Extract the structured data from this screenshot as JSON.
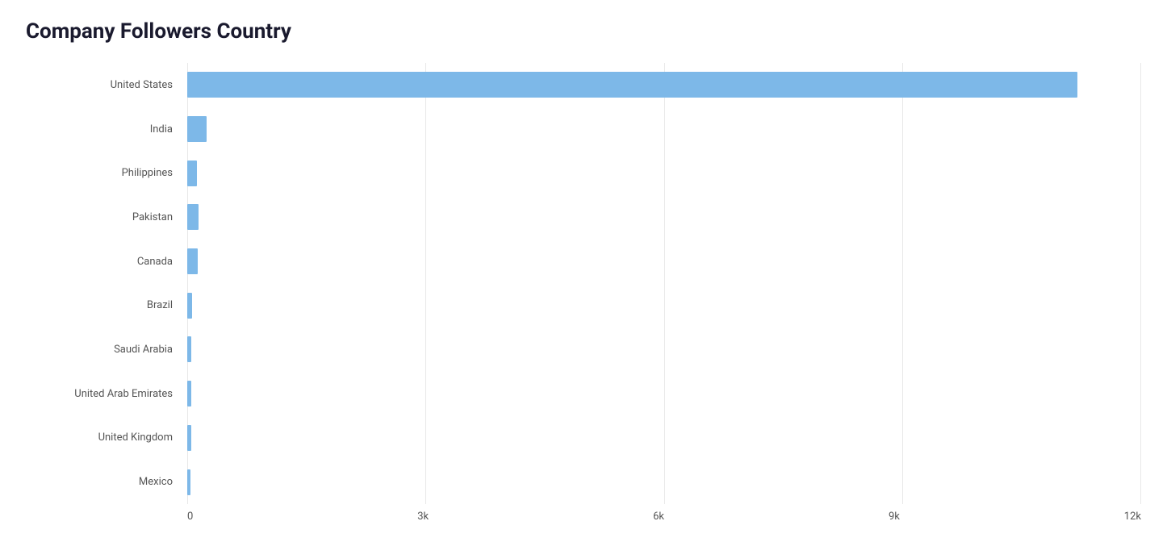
{
  "chart": {
    "title": "Company Followers Country",
    "bar_color": "#7db8e8",
    "max_value": 12000,
    "x_axis_labels": [
      "0",
      "3k",
      "6k",
      "9k",
      "12k"
    ],
    "countries": [
      {
        "name": "United States",
        "value": 11200
      },
      {
        "name": "India",
        "value": 240
      },
      {
        "name": "Philippines",
        "value": 120
      },
      {
        "name": "Pakistan",
        "value": 140
      },
      {
        "name": "Canada",
        "value": 130
      },
      {
        "name": "Brazil",
        "value": 60
      },
      {
        "name": "Saudi Arabia",
        "value": 55
      },
      {
        "name": "United Arab Emirates",
        "value": 50
      },
      {
        "name": "United Kingdom",
        "value": 48
      },
      {
        "name": "Mexico",
        "value": 40
      }
    ]
  }
}
